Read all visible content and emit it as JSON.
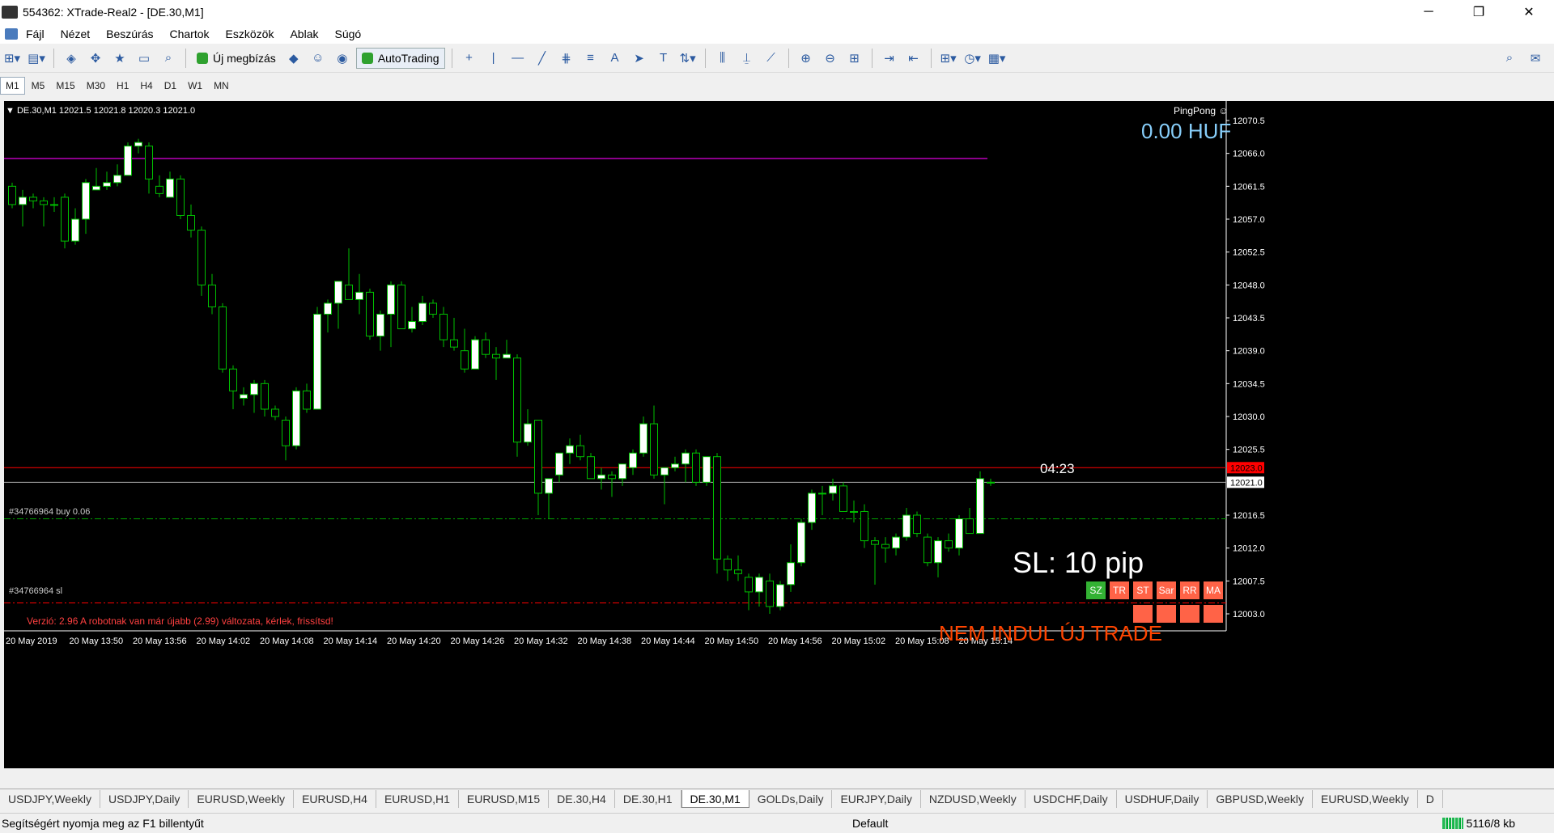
{
  "window": {
    "title": "554362: XTrade-Real2 - [DE.30,M1]",
    "minimize": "─",
    "maximize": "❐",
    "close": "✕"
  },
  "mdi": {
    "minimize": "─",
    "restore": "❐",
    "close": "✕"
  },
  "menu": [
    "Fájl",
    "Nézet",
    "Beszúrás",
    "Chartok",
    "Eszközök",
    "Ablak",
    "Súgó"
  ],
  "toolbar": {
    "new_order": "Új megbízás",
    "autotrading": "AutoTrading"
  },
  "timeframes": [
    "M1",
    "M5",
    "M15",
    "M30",
    "H1",
    "H4",
    "D1",
    "W1",
    "MN"
  ],
  "chart": {
    "header": "▼ DE.30,M1  12021.5 12021.8 12020.3 12021.0",
    "ea_name": "PingPong ☺",
    "balance": "0.00 HUF",
    "countdown": "04:23",
    "sl_text": "SL: 10 pip",
    "status_text": "NEM INDUL ÚJ TRADE",
    "order_label": "#34766964 buy 0.06",
    "sl_label": "#34766964 sl",
    "version_text": "Verzió: 2.96  A robotnak van már újabb (2.99) változata, kérlek, frissítsd!",
    "buttons": [
      "SZ",
      "TR",
      "ST",
      "Sar",
      "RR",
      "MA"
    ],
    "price_labels": [
      "12070.5",
      "12066.0",
      "12061.5",
      "12057.0",
      "12052.5",
      "12048.0",
      "12043.5",
      "12039.0",
      "12034.5",
      "12030.0",
      "12025.5",
      "12016.5",
      "12012.0",
      "12007.5",
      "12003.0"
    ],
    "current_bid": "12021.0",
    "ask_label": "12023.0",
    "time_labels": [
      "20 May 2019",
      "20 May 13:50",
      "20 May 13:56",
      "20 May 14:02",
      "20 May 14:08",
      "20 May 14:14",
      "20 May 14:20",
      "20 May 14:26",
      "20 May 14:32",
      "20 May 14:38",
      "20 May 14:44",
      "20 May 14:50",
      "20 May 14:56",
      "20 May 15:02",
      "20 May 15:08",
      "20 May 15:14"
    ],
    "colors": {
      "up": "#ffffff",
      "down": "#000000",
      "wick": "#00c000",
      "ask_line": "#ff0000",
      "purple_line": "#8b008b",
      "order_line": "#00a000",
      "sl_line": "#ff0000",
      "balance": "#87cefa",
      "status": "#ff4500"
    },
    "candles": [
      [
        12061.5,
        12062.0,
        12058.5,
        12059.0
      ],
      [
        12059.0,
        12061.0,
        12056.0,
        12060.0
      ],
      [
        12060.0,
        12060.5,
        12058.5,
        12059.5
      ],
      [
        12059.5,
        12060.0,
        12056.0,
        12059.0
      ],
      [
        12059.0,
        12060.0,
        12058.0,
        12059.0
      ],
      [
        12060.0,
        12060.5,
        12053.0,
        12054.0
      ],
      [
        12054.0,
        12058.5,
        12053.5,
        12057.0
      ],
      [
        12057.0,
        12062.5,
        12055.0,
        12062.0
      ],
      [
        12061.0,
        12064.0,
        12061.0,
        12061.5
      ],
      [
        12061.5,
        12063.5,
        12061.0,
        12062.0
      ],
      [
        12062.0,
        12064.5,
        12061.5,
        12063.0
      ],
      [
        12063.0,
        12067.5,
        12063.0,
        12067.0
      ],
      [
        12067.0,
        12068.0,
        12066.0,
        12067.5
      ],
      [
        12067.0,
        12067.5,
        12060.5,
        12062.5
      ],
      [
        12061.5,
        12063.0,
        12060.0,
        12060.5
      ],
      [
        12060.0,
        12063.5,
        12060.0,
        12062.5
      ],
      [
        12062.5,
        12063.0,
        12057.0,
        12057.5
      ],
      [
        12057.5,
        12059.0,
        12054.5,
        12055.5
      ],
      [
        12055.5,
        12056.0,
        12046.5,
        12048.0
      ],
      [
        12048.0,
        12049.5,
        12044.0,
        12045.0
      ],
      [
        12045.0,
        12045.5,
        12036.0,
        12036.5
      ],
      [
        12036.5,
        12037.0,
        12031.0,
        12033.5
      ],
      [
        12032.5,
        12034.0,
        12031.5,
        12033.0
      ],
      [
        12033.0,
        12035.0,
        12030.5,
        12034.5
      ],
      [
        12034.5,
        12035.0,
        12030.0,
        12031.0
      ],
      [
        12031.0,
        12031.5,
        12029.5,
        12030.0
      ],
      [
        12029.5,
        12030.0,
        12024.0,
        12026.0
      ],
      [
        12026.0,
        12034.0,
        12025.5,
        12033.5
      ],
      [
        12033.5,
        12034.5,
        12030.5,
        12031.0
      ],
      [
        12031.0,
        12045.0,
        12031.0,
        12044.0
      ],
      [
        12044.0,
        12046.0,
        12041.5,
        12045.5
      ],
      [
        12045.5,
        12048.5,
        12042.0,
        12048.5
      ],
      [
        12048.0,
        12053.0,
        12046.0,
        12046.0
      ],
      [
        12046.0,
        12049.5,
        12044.0,
        12047.0
      ],
      [
        12047.0,
        12047.5,
        12040.5,
        12041.0
      ],
      [
        12041.0,
        12044.5,
        12039.0,
        12044.0
      ],
      [
        12044.0,
        12048.5,
        12039.5,
        12048.0
      ],
      [
        12048.0,
        12048.5,
        12042.0,
        12042.0
      ],
      [
        12042.0,
        12045.0,
        12041.5,
        12043.0
      ],
      [
        12043.0,
        12046.5,
        12042.5,
        12045.5
      ],
      [
        12045.5,
        12046.0,
        12043.5,
        12044.0
      ],
      [
        12044.0,
        12045.0,
        12039.5,
        12040.5
      ],
      [
        12040.5,
        12043.5,
        12039.0,
        12039.5
      ],
      [
        12039.0,
        12042.0,
        12036.0,
        12036.5
      ],
      [
        12036.5,
        12041.0,
        12036.5,
        12040.5
      ],
      [
        12040.5,
        12041.5,
        12038.0,
        12038.5
      ],
      [
        12038.5,
        12039.5,
        12035.0,
        12038.0
      ],
      [
        12038.0,
        12040.5,
        12038.0,
        12038.5
      ],
      [
        12038.0,
        12038.5,
        12024.5,
        12026.5
      ],
      [
        12026.5,
        12031.0,
        12026.0,
        12029.0
      ],
      [
        12029.5,
        12029.5,
        12016.5,
        12019.5
      ],
      [
        12019.5,
        12021.0,
        12016.0,
        12021.5
      ],
      [
        12022.0,
        12024.0,
        12021.0,
        12025.0
      ],
      [
        12025.0,
        12027.0,
        12023.5,
        12026.0
      ],
      [
        12026.0,
        12027.5,
        12024.0,
        12024.5
      ],
      [
        12024.5,
        12025.0,
        12021.5,
        12021.5
      ],
      [
        12021.5,
        12023.0,
        12020.0,
        12022.0
      ],
      [
        12022.0,
        12022.5,
        12019.0,
        12021.5
      ],
      [
        12021.5,
        12023.0,
        12020.5,
        12023.5
      ],
      [
        12023.0,
        12025.5,
        12022.0,
        12025.0
      ],
      [
        12025.0,
        12030.0,
        12024.5,
        12029.0
      ],
      [
        12029.0,
        12031.5,
        12021.5,
        12022.0
      ],
      [
        12022.0,
        12023.0,
        12018.0,
        12023.0
      ],
      [
        12023.0,
        12024.5,
        12022.5,
        12023.5
      ],
      [
        12023.5,
        12025.5,
        12021.0,
        12025.0
      ],
      [
        12025.0,
        12025.5,
        12020.5,
        12021.0
      ],
      [
        12021.0,
        12022.0,
        12020.5,
        12024.5
      ],
      [
        12024.5,
        12025.0,
        12008.5,
        12010.5
      ],
      [
        12010.5,
        12011.0,
        12007.5,
        12009.0
      ],
      [
        12009.0,
        12011.0,
        12007.5,
        12008.5
      ],
      [
        12008.0,
        12008.5,
        12003.5,
        12006.0
      ],
      [
        12006.0,
        12008.5,
        12004.0,
        12008.0
      ],
      [
        12007.5,
        12008.5,
        12003.0,
        12004.0
      ],
      [
        12004.0,
        12007.5,
        12003.5,
        12007.0
      ],
      [
        12007.0,
        12012.5,
        12006.0,
        12010.0
      ],
      [
        12010.0,
        12016.0,
        12009.5,
        12015.5
      ],
      [
        12015.5,
        12020.0,
        12014.5,
        12019.5
      ],
      [
        12019.5,
        12020.5,
        12016.5,
        12019.5
      ],
      [
        12019.5,
        12021.5,
        12018.5,
        12020.5
      ],
      [
        12020.5,
        12021.0,
        12018.0,
        12017.0
      ],
      [
        12017.0,
        12018.5,
        12015.5,
        12017.0
      ],
      [
        12017.0,
        12018.0,
        12012.0,
        12013.0
      ],
      [
        12013.0,
        12013.5,
        12007.0,
        12012.5
      ],
      [
        12012.5,
        12013.5,
        12010.0,
        12012.0
      ],
      [
        12012.0,
        12014.0,
        12011.0,
        12013.5
      ],
      [
        12013.5,
        12017.5,
        12013.0,
        12016.5
      ],
      [
        12016.5,
        12017.0,
        12013.5,
        12014.0
      ],
      [
        12013.5,
        12014.0,
        12009.5,
        12010.0
      ],
      [
        12010.0,
        12013.5,
        12008.0,
        12013.0
      ],
      [
        12013.0,
        12014.0,
        12011.5,
        12012.0
      ],
      [
        12012.0,
        12016.5,
        12011.0,
        12016.0
      ],
      [
        12016.0,
        12017.5,
        12014.5,
        12014.0
      ],
      [
        12014.0,
        12022.5,
        12014.0,
        12021.5
      ],
      [
        12021.0,
        12021.5,
        12020.5,
        12021.0
      ]
    ]
  },
  "tabs": [
    "USDJPY,Weekly",
    "USDJPY,Daily",
    "EURUSD,Weekly",
    "EURUSD,H4",
    "EURUSD,H1",
    "EURUSD,M15",
    "DE.30,H4",
    "DE.30,H1",
    "DE.30,M1",
    "GOLDs,Daily",
    "EURJPY,Daily",
    "NZDUSD,Weekly",
    "USDCHF,Daily",
    "USDHUF,Daily",
    "GBPUSD,Weekly",
    "EURUSD,Weekly",
    "D"
  ],
  "active_tab": "DE.30,M1",
  "status": {
    "help": "Segítségért nyomja meg az F1 billentyűt",
    "profile": "Default",
    "traffic": "5116/8 kb"
  }
}
